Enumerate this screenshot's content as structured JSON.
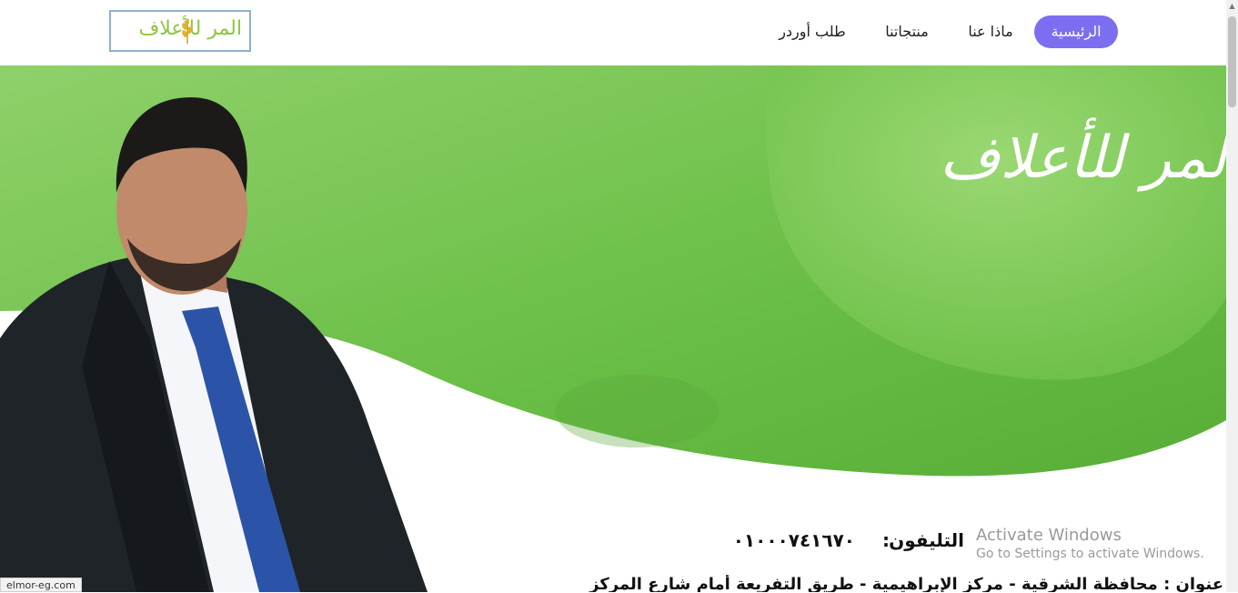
{
  "header": {
    "logo_text": "المر للأعلاف",
    "nav": {
      "home": "الرئيسية",
      "about": "ماذا عنا",
      "products": "منتجاتنا",
      "order": "طلب أوردر"
    }
  },
  "hero": {
    "brand_text": "لمر للأعلاف",
    "phone_label": "التليفون",
    "phone_separator": ":",
    "phone_value": "٠١٠٠٠٧٤١٦٧٠",
    "address_text": "عنوان : محافظة الشرقية - مركز الإبراهيمية - طريق التفريعة أمام شارع المركز"
  },
  "overlay": {
    "activate_title": "Activate Windows",
    "activate_sub": "Go to Settings to activate Windows."
  },
  "status_bar": {
    "url": "elmor-eg.com"
  },
  "colors": {
    "nav_active": "#7b6ef0",
    "green_primary": "#6dc04a",
    "green_light": "#95d167",
    "logo_green": "#8cc63f"
  },
  "icons": [
    "wheat-icon",
    "scroll-up-icon"
  ]
}
